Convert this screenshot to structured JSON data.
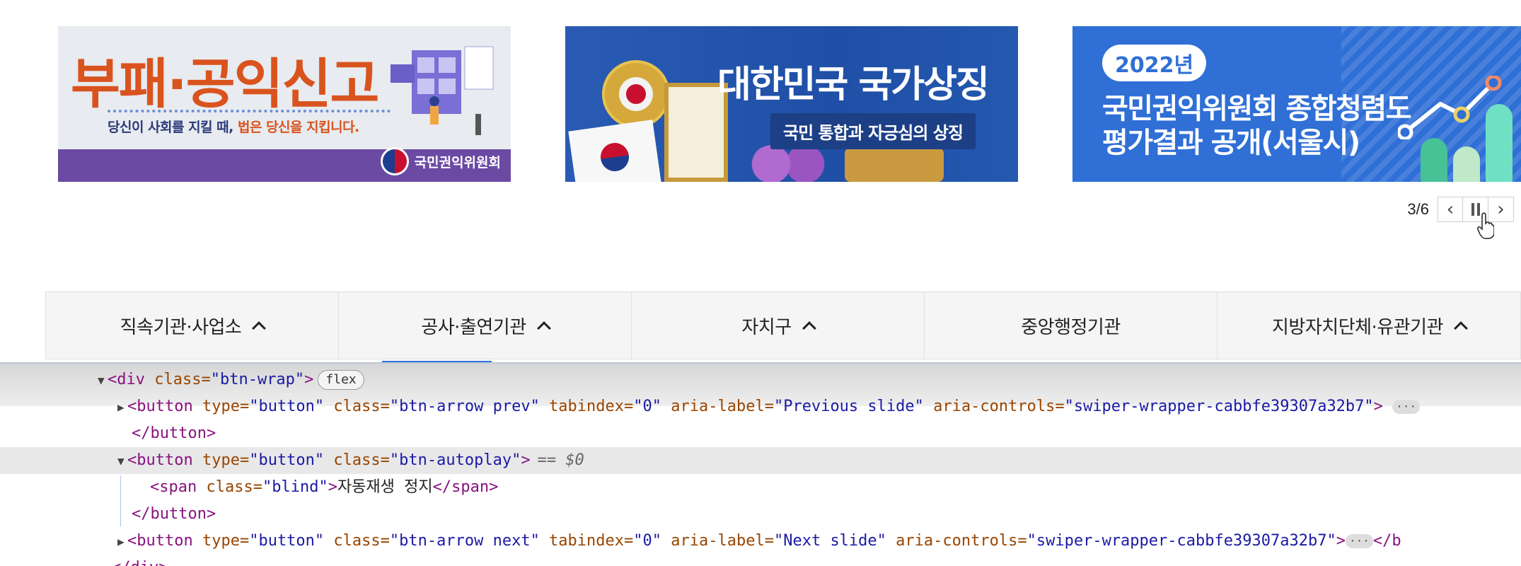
{
  "carousel": {
    "banners": [
      {
        "headline": "부패·공익신고",
        "subtitle_part1": "당신이 사회를 지킬 때, ",
        "subtitle_part2": "법은 당신을 지킵니다.",
        "org": "국민권익위원회"
      },
      {
        "title": "대한민국 국가상징",
        "subtitle": "국민 통합과 자긍심의 상징"
      },
      {
        "year": "2022년",
        "line1": "국민권익위원회 종합청렴도",
        "line2": "평가결과 공개(서울시)"
      }
    ],
    "counter": "3/6",
    "prev_icon": "chevron-left-icon",
    "pause_icon": "pause-icon",
    "next_icon": "chevron-right-icon"
  },
  "tabs": [
    {
      "label": "직속기관·사업소",
      "icon": "chevron-up-icon"
    },
    {
      "label": "공사·출연기관",
      "icon": "chevron-up-icon"
    },
    {
      "label": "자치구",
      "icon": "chevron-up-icon"
    },
    {
      "label": "중앙행정기관",
      "icon": ""
    },
    {
      "label": "지방자치단체·유관기관",
      "icon": "chevron-up-icon"
    }
  ],
  "devtools": {
    "div_open": "<div ",
    "div_class_attr": "class=",
    "div_class_val": "\"btn-wrap\"",
    "div_close_bracket": ">",
    "flex_badge": "flex",
    "prev_button": {
      "open": "<button ",
      "a1": "type=",
      "v1": "\"button\"",
      "a2": " class=",
      "v2": "\"btn-arrow prev\"",
      "a3": " tabindex=",
      "v3": "\"0\"",
      "a4": " aria-label=",
      "v4": "\"Previous slide\"",
      "a5": " aria-controls=",
      "v5": "\"swiper-wrapper-cabbfe39307a32b7\"",
      "close": ">"
    },
    "button_close": "</button>",
    "autoplay_button": {
      "open": "<button ",
      "a1": "type=",
      "v1": "\"button\"",
      "a2": " class=",
      "v2": "\"btn-autoplay\"",
      "close": ">",
      "eq": "== $0"
    },
    "span_open": "<span ",
    "span_attr": "class=",
    "span_val": "\"blind\"",
    "span_gt": ">",
    "span_text": "자동재생 정지",
    "span_close": "</span>",
    "next_button": {
      "open": "<button ",
      "a1": "type=",
      "v1": "\"button\"",
      "a2": " class=",
      "v2": "\"btn-arrow next\"",
      "a3": " tabindex=",
      "v3": "\"0\"",
      "a4": " aria-label=",
      "v4": "\"Next slide\"",
      "a5": " aria-controls=",
      "v5": "\"swiper-wrapper-cabbfe39307a32b7\"",
      "close": ">",
      "tail": "</b"
    },
    "div_end": "</div>"
  }
}
